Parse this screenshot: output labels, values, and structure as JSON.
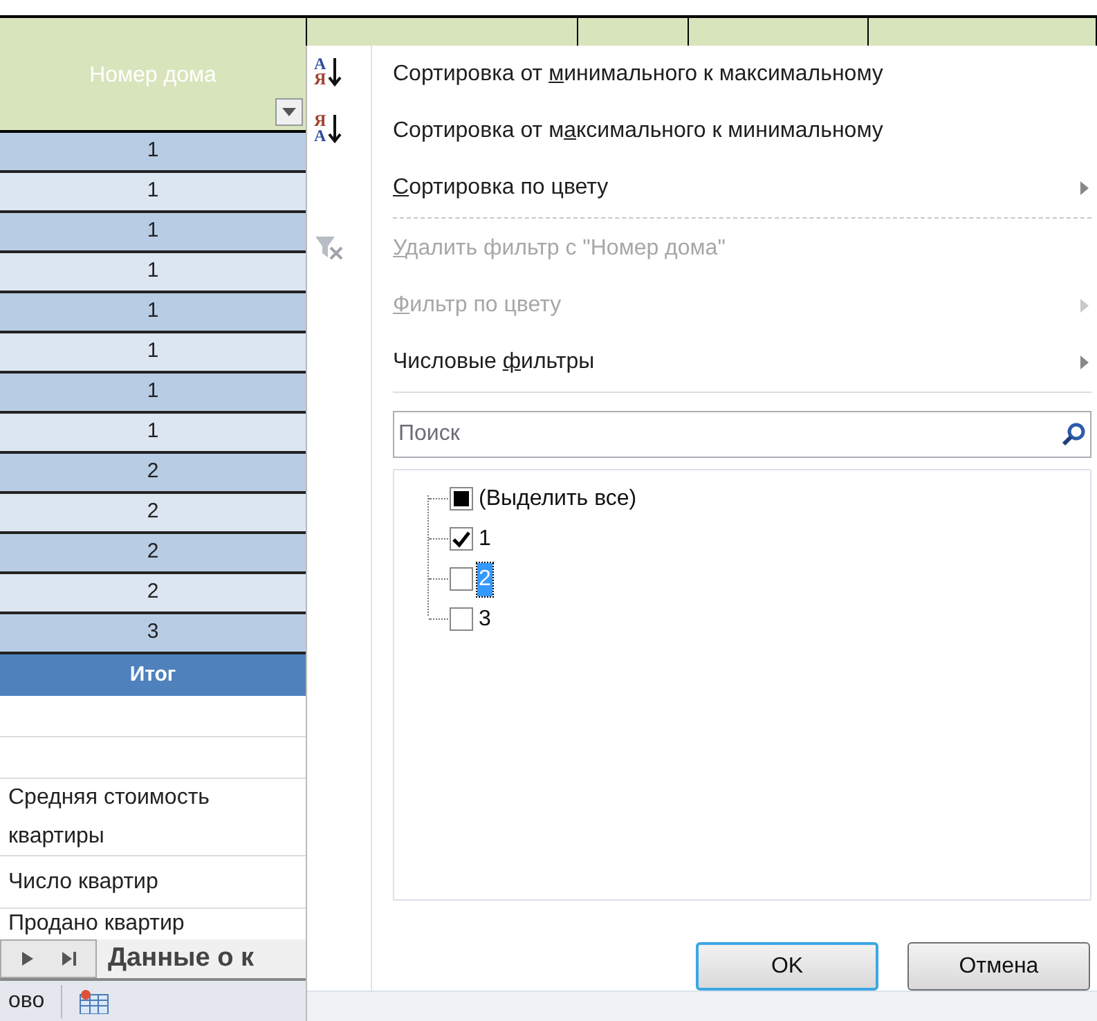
{
  "sheet": {
    "header": "Номер дома",
    "rows": [
      "1",
      "1",
      "1",
      "1",
      "1",
      "1",
      "1",
      "1",
      "2",
      "2",
      "2",
      "2",
      "3"
    ],
    "total": "Итог",
    "labels": [
      "Средняя стоимость квартиры",
      "Число квартир",
      "Продано квартир"
    ],
    "sheet_tab": "Данные о к",
    "status_text": "ово"
  },
  "menu": {
    "items": [
      {
        "kind": "sort",
        "icon_letters": [
          "A",
          "Я"
        ],
        "before": "Сортировка от ",
        "key": "м",
        "after": "инимального к максимальному",
        "disabled": false,
        "submenu": false,
        "separator_after": false
      },
      {
        "kind": "sort",
        "icon_letters": [
          "Я",
          "A"
        ],
        "before": "Сортировка от м",
        "key": "а",
        "after": "ксимального к минимальному",
        "disabled": false,
        "submenu": false,
        "separator_after": false
      },
      {
        "kind": "plain",
        "key": "С",
        "after": "ортировка по цвету",
        "disabled": false,
        "submenu": true,
        "separator_after": true
      },
      {
        "kind": "clear-filter",
        "key": "У",
        "after": "далить фильтр с \"Номер дома\"",
        "disabled": true,
        "submenu": false,
        "separator_after": false
      },
      {
        "kind": "plain",
        "key": "Ф",
        "after": "ильтр по цвету",
        "disabled": true,
        "submenu": true,
        "separator_after": false
      },
      {
        "kind": "plain",
        "before": "Числовые ",
        "key": "ф",
        "after": "ильтры",
        "disabled": false,
        "submenu": true,
        "separator_after": true
      }
    ],
    "search": {
      "placeholder": "Поиск"
    },
    "values": [
      {
        "label": "(Выделить все)",
        "checked": false,
        "mixed": true,
        "selected": false
      },
      {
        "label": "1",
        "checked": true,
        "mixed": false,
        "selected": false
      },
      {
        "label": "2",
        "checked": false,
        "mixed": false,
        "selected": true
      },
      {
        "label": "3",
        "checked": false,
        "mixed": false,
        "selected": false
      }
    ],
    "buttons": [
      {
        "label": "OK",
        "default": true
      },
      {
        "label": "Отмена",
        "default": false
      }
    ]
  }
}
